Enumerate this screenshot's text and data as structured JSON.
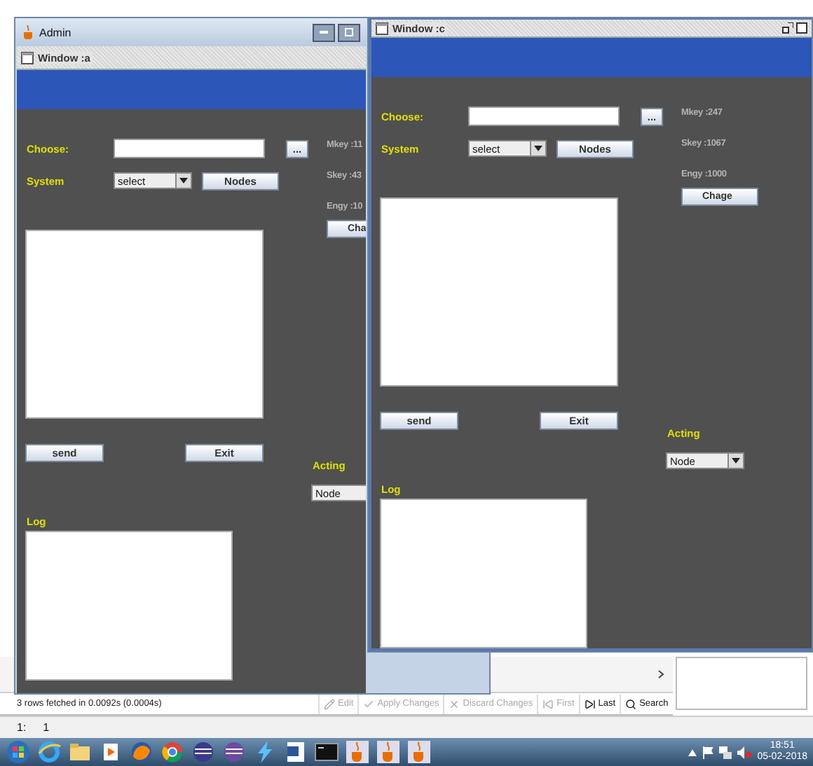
{
  "admin_window": {
    "title": "Admin",
    "internal_frame": {
      "title": "Window :a",
      "form": {
        "choose_label": "Choose:",
        "browse_button": "...",
        "system_label": "System",
        "system_select": "select",
        "nodes_button": "Nodes",
        "mkey": "Mkey :11",
        "skey": "Skey :43",
        "engy": "Engy :10",
        "change_button": "Cha",
        "send_button": "send",
        "exit_button": "Exit",
        "acting_label": "Acting",
        "acting_select": "Node",
        "log_label": "Log"
      }
    }
  },
  "window_c": {
    "title": "Window :c",
    "form": {
      "choose_label": "Choose:",
      "browse_button": "...",
      "system_label": "System",
      "system_select": "select",
      "nodes_button": "Nodes",
      "mkey": "Mkey :247",
      "skey": "Skey :1067",
      "engy": "Engy :1000",
      "change_button": "Chage",
      "send_button": "send",
      "exit_button": "Exit",
      "acting_label": "Acting",
      "acting_select": "Node",
      "log_label": "Log"
    }
  },
  "status_bar": {
    "message": "3 rows fetched in 0.0092s (0.0004s)",
    "buttons": [
      {
        "kind": "edit",
        "label": "Edit",
        "disabled": true
      },
      {
        "kind": "apply",
        "label": "Apply Changes",
        "disabled": true
      },
      {
        "kind": "discard",
        "label": "Discard Changes",
        "disabled": true
      },
      {
        "kind": "first",
        "label": "First",
        "disabled": true
      },
      {
        "kind": "last",
        "label": "Last",
        "disabled": false
      },
      {
        "kind": "search",
        "label": "Search",
        "disabled": false
      }
    ]
  },
  "position_bar": {
    "line": "1:",
    "column": "1"
  },
  "taskbar": {
    "time": "18:51",
    "date": "05-02-2018"
  }
}
